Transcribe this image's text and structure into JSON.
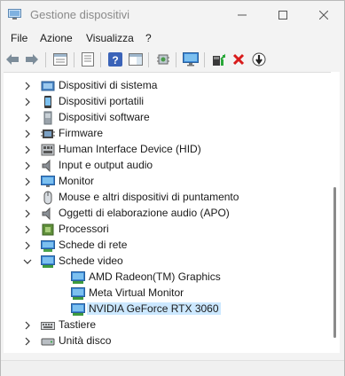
{
  "window": {
    "title": "Gestione dispositivi"
  },
  "menu": [
    {
      "label": "File"
    },
    {
      "label": "Azione"
    },
    {
      "label": "Visualizza"
    },
    {
      "label": "?"
    }
  ],
  "toolbar": {
    "icons": [
      "back-arrow-icon",
      "forward-arrow-icon",
      "properties-icon",
      "print-view-icon",
      "help-icon",
      "action-pane-icon",
      "scan-hardware-icon",
      "monitor-icon",
      "update-driver-icon",
      "uninstall-device-icon",
      "disable-device-icon"
    ]
  },
  "tree": {
    "items": [
      {
        "label": "Dispositivi di sistema",
        "icon": "system-devices-icon",
        "expanded": false
      },
      {
        "label": "Dispositivi portatili",
        "icon": "portable-devices-icon",
        "expanded": false
      },
      {
        "label": "Dispositivi software",
        "icon": "software-devices-icon",
        "expanded": false
      },
      {
        "label": "Firmware",
        "icon": "firmware-icon",
        "expanded": false
      },
      {
        "label": "Human Interface Device (HID)",
        "icon": "hid-icon",
        "expanded": false
      },
      {
        "label": "Input e output audio",
        "icon": "speaker-icon",
        "expanded": false
      },
      {
        "label": "Monitor",
        "icon": "monitor-icon",
        "expanded": false
      },
      {
        "label": "Mouse e altri dispositivi di puntamento",
        "icon": "mouse-icon",
        "expanded": false
      },
      {
        "label": "Oggetti di elaborazione audio (APO)",
        "icon": "speaker-icon",
        "expanded": false
      },
      {
        "label": "Processori",
        "icon": "processor-icon",
        "expanded": false
      },
      {
        "label": "Schede di rete",
        "icon": "network-adapter-icon",
        "expanded": false
      },
      {
        "label": "Schede video",
        "icon": "display-adapter-icon",
        "expanded": true
      },
      {
        "label": "AMD Radeon(TM) Graphics",
        "icon": "display-adapter-icon",
        "child": true
      },
      {
        "label": "Meta Virtual Monitor",
        "icon": "display-adapter-icon",
        "child": true
      },
      {
        "label": "NVIDIA GeForce RTX 3060",
        "icon": "display-adapter-icon",
        "child": true,
        "selected": true
      },
      {
        "label": "Tastiere",
        "icon": "keyboard-icon",
        "expanded": false
      },
      {
        "label": "Unità disco",
        "icon": "disk-drive-icon",
        "expanded": false
      }
    ]
  },
  "colors": {
    "selection": "#cce8ff",
    "accent": "#2a7fd4",
    "error_red": "#d81b1b",
    "ok_green": "#2aa83a"
  }
}
